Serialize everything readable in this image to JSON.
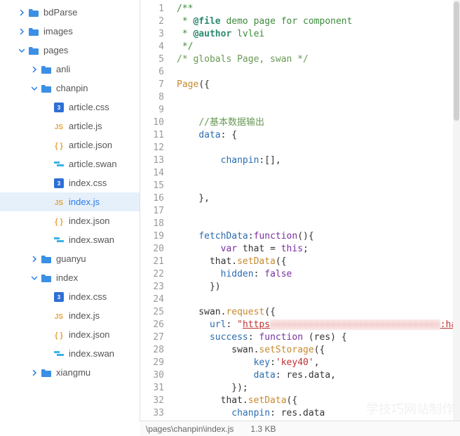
{
  "sidebar": {
    "items": [
      {
        "depth": 1,
        "chev": "right",
        "kind": "folder",
        "label": "bdParse",
        "sel": false
      },
      {
        "depth": 1,
        "chev": "right",
        "kind": "folder",
        "label": "images",
        "sel": false
      },
      {
        "depth": 1,
        "chev": "down",
        "kind": "folder",
        "label": "pages",
        "sel": false
      },
      {
        "depth": 2,
        "chev": "right",
        "kind": "folder",
        "label": "anli",
        "sel": false
      },
      {
        "depth": 2,
        "chev": "down",
        "kind": "folder",
        "label": "chanpin",
        "sel": false
      },
      {
        "depth": 3,
        "chev": "",
        "kind": "css",
        "label": "article.css",
        "sel": false
      },
      {
        "depth": 3,
        "chev": "",
        "kind": "js",
        "label": "article.js",
        "sel": false
      },
      {
        "depth": 3,
        "chev": "",
        "kind": "json",
        "label": "article.json",
        "sel": false
      },
      {
        "depth": 3,
        "chev": "",
        "kind": "swan",
        "label": "article.swan",
        "sel": false
      },
      {
        "depth": 3,
        "chev": "",
        "kind": "css",
        "label": "index.css",
        "sel": false
      },
      {
        "depth": 3,
        "chev": "",
        "kind": "js",
        "label": "index.js",
        "sel": true
      },
      {
        "depth": 3,
        "chev": "",
        "kind": "json",
        "label": "index.json",
        "sel": false
      },
      {
        "depth": 3,
        "chev": "",
        "kind": "swan",
        "label": "index.swan",
        "sel": false
      },
      {
        "depth": 2,
        "chev": "right",
        "kind": "folder",
        "label": "guanyu",
        "sel": false
      },
      {
        "depth": 2,
        "chev": "down",
        "kind": "folder",
        "label": "index",
        "sel": false
      },
      {
        "depth": 3,
        "chev": "",
        "kind": "css",
        "label": "index.css",
        "sel": false
      },
      {
        "depth": 3,
        "chev": "",
        "kind": "js",
        "label": "index.js",
        "sel": false
      },
      {
        "depth": 3,
        "chev": "",
        "kind": "json",
        "label": "index.json",
        "sel": false
      },
      {
        "depth": 3,
        "chev": "",
        "kind": "swan",
        "label": "index.swan",
        "sel": false
      },
      {
        "depth": 2,
        "chev": "right",
        "kind": "folder",
        "label": "xiangmu",
        "sel": false
      }
    ]
  },
  "code": {
    "lines": [
      {
        "n": 1,
        "h": "<span class='c-doc'>/**</span>"
      },
      {
        "n": 2,
        "h": "<span class='c-doc'> * <span class='c-tag'>@file</span> demo page for component</span>"
      },
      {
        "n": 3,
        "h": "<span class='c-doc'> * <span class='c-tag'>@author</span> lvlei</span>"
      },
      {
        "n": 4,
        "h": "<span class='c-doc'> */</span>"
      },
      {
        "n": 5,
        "h": "<span class='c-comment'>/* globals Page, swan */</span>"
      },
      {
        "n": 6,
        "h": ""
      },
      {
        "n": 7,
        "h": "<span class='c-fn'>Page</span>({"
      },
      {
        "n": 8,
        "h": ""
      },
      {
        "n": 9,
        "h": ""
      },
      {
        "n": 10,
        "h": "    <span class='c-comment'>//基本数据输出</span>"
      },
      {
        "n": 11,
        "h": "    <span class='c-prop'>data</span>: {"
      },
      {
        "n": 12,
        "h": ""
      },
      {
        "n": 13,
        "h": "        <span class='c-prop'>chanpin</span>:[],"
      },
      {
        "n": 14,
        "h": ""
      },
      {
        "n": 15,
        "h": ""
      },
      {
        "n": 16,
        "h": "    },"
      },
      {
        "n": 17,
        "h": ""
      },
      {
        "n": 18,
        "h": ""
      },
      {
        "n": 19,
        "h": "    <span class='c-prop'>fetchData</span>:<span class='c-kw'>function</span>(){"
      },
      {
        "n": 20,
        "h": "        <span class='c-kw'>var</span> that = <span class='c-this'>this</span>;"
      },
      {
        "n": 21,
        "h": "      that.<span class='c-fn'>setData</span>({"
      },
      {
        "n": 22,
        "h": "        <span class='c-prop'>hidden</span>: <span class='c-bool'>false</span>"
      },
      {
        "n": 23,
        "h": "      })"
      },
      {
        "n": 24,
        "h": ""
      },
      {
        "n": 25,
        "h": "    swan.<span class='c-fn'>request</span>({"
      },
      {
        "n": 26,
        "h": "      <span class='c-prop'>url</span>: <span class='c-str'>\"</span><span class='c-url'>https</span><span class='blurred'>xxxxxxxxxxxxxxxxxxxxxxxxxxxxxxx</span><span class='c-url'>:hanpin_list.php</span><span class='c-str'>\"</span>,"
      },
      {
        "n": 27,
        "h": "      <span class='c-prop'>success</span>: <span class='c-kw'>function</span> (res) {"
      },
      {
        "n": 28,
        "h": "          swan.<span class='c-fn'>setStorage</span>({"
      },
      {
        "n": 29,
        "h": "              <span class='c-prop'>key</span>:<span class='c-str'>'key40'</span>,"
      },
      {
        "n": 30,
        "h": "              <span class='c-prop'>data</span>: res.data,"
      },
      {
        "n": 31,
        "h": "          });"
      },
      {
        "n": 32,
        "h": "        that.<span class='c-fn'>setData</span>({"
      },
      {
        "n": 33,
        "h": "          <span class='c-prop'>chanpin</span>: res.data"
      }
    ]
  },
  "statusbar": {
    "path": "\\pages\\chanpin\\index.js",
    "size": "1.3 KB"
  },
  "watermark": "学技巧网站制作"
}
